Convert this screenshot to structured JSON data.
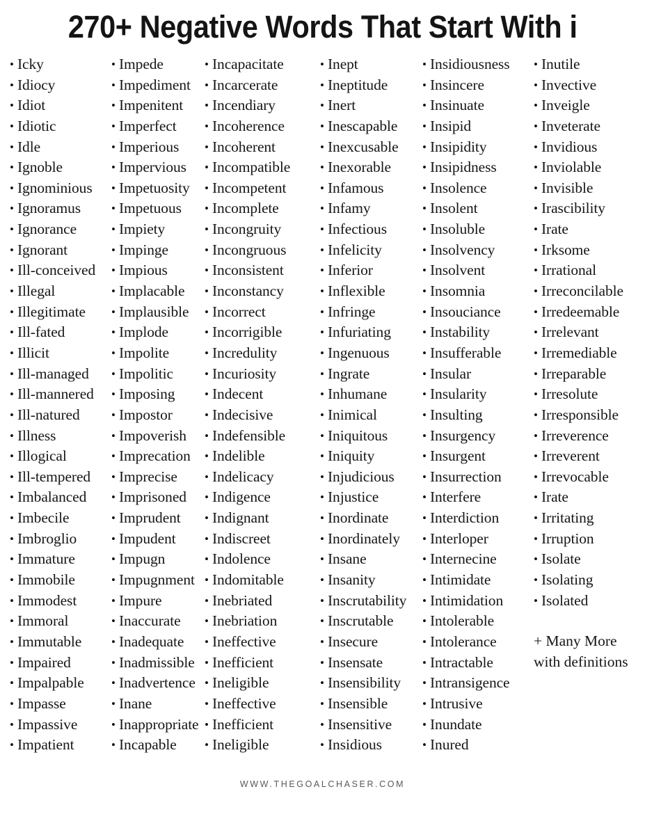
{
  "page": {
    "title": "270+ Negative Words That Start With i",
    "background_color": "#ffffff",
    "text_color": "#161616"
  },
  "footer": {
    "url": "WWW.THEGOALCHASER.COM",
    "color": "#59595b"
  },
  "bullet_glyph": "•",
  "note": {
    "line1": "+ Many More",
    "line2": "with definitions"
  },
  "columns": [
    {
      "index": 1,
      "words": [
        "Icky",
        "Idiocy",
        "Idiot",
        "Idiotic",
        "Idle",
        "Ignoble",
        "Ignominious",
        "Ignoramus",
        "Ignorance",
        "Ignorant",
        "Ill-conceived",
        "Illegal",
        "Illegitimate",
        "Ill-fated",
        "Illicit",
        "Ill-managed",
        "Ill-mannered",
        "Ill-natured",
        "Illness",
        "Illogical",
        "Ill-tempered",
        "Imbalanced",
        "Imbecile",
        "Imbroglio",
        "Immature",
        "Immobile",
        "Immodest",
        "Immoral",
        "Immutable",
        "Impaired",
        "Impalpable",
        "Impasse",
        "Impassive",
        "Impatient"
      ]
    },
    {
      "index": 2,
      "words": [
        "Impede",
        "Impediment",
        "Impenitent",
        "Imperfect",
        "Imperious",
        "Impervious",
        "Impetuosity",
        "Impetuous",
        "Impiety",
        "Impinge",
        "Impious",
        "Implacable",
        "Implausible",
        "Implode",
        "Impolite",
        "Impolitic",
        "Imposing",
        "Impostor",
        "Impoverish",
        "Imprecation",
        "Imprecise",
        "Imprisoned",
        "Imprudent",
        "Impudent",
        "Impugn",
        "Impugnment",
        "Impure",
        "Inaccurate",
        "Inadequate",
        "Inadmissible",
        "Inadvertence",
        "Inane",
        "Inappropriate",
        "Incapable"
      ]
    },
    {
      "index": 3,
      "words": [
        "Incapacitate",
        "Incarcerate",
        "Incendiary",
        "Incoherence",
        "Incoherent",
        "Incompatible",
        "Incompetent",
        "Incomplete",
        "Incongruity",
        "Incongruous",
        "Inconsistent",
        "Inconstancy",
        "Incorrect",
        "Incorrigible",
        "Incredulity",
        "Incuriosity",
        "Indecent",
        "Indecisive",
        "Indefensible",
        "Indelible",
        "Indelicacy",
        "Indigence",
        "Indignant",
        "Indiscreet",
        "Indolence",
        "Indomitable",
        "Inebriated",
        "Inebriation",
        "Ineffective",
        "Inefficient",
        "Ineligible",
        "Ineffective",
        "Inefficient",
        "Ineligible"
      ]
    },
    {
      "index": 4,
      "words": [
        "Inept",
        "Ineptitude",
        "Inert",
        "Inescapable",
        "Inexcusable",
        "Inexorable",
        "Infamous",
        "Infamy",
        "Infectious",
        "Infelicity",
        "Inferior",
        "Inflexible",
        "Infringe",
        "Infuriating",
        "Ingenuous",
        "Ingrate",
        "Inhumane",
        "Inimical",
        "Iniquitous",
        "Iniquity",
        "Injudicious",
        "Injustice",
        "Inordinate",
        "Inordinately",
        "Insane",
        "Insanity",
        "Inscrutability",
        "Inscrutable",
        "Insecure",
        "Insensate",
        "Insensibility",
        "Insensible",
        "Insensitive",
        "Insidious"
      ]
    },
    {
      "index": 5,
      "words": [
        "Insidiousness",
        "Insincere",
        "Insinuate",
        "Insipid",
        "Insipidity",
        "Insipidness",
        "Insolence",
        "Insolent",
        "Insoluble",
        "Insolvency",
        "Insolvent",
        "Insomnia",
        "Insouciance",
        "Instability",
        "Insufferable",
        "Insular",
        "Insularity",
        "Insulting",
        "Insurgency",
        "Insurgent",
        "Insurrection",
        "Interfere",
        "Interdiction",
        "Interloper",
        "Internecine",
        "Intimidate",
        "Intimidation",
        "Intolerable",
        "Intolerance",
        "Intractable",
        "Intransigence",
        "Intrusive",
        "Inundate",
        "Inured"
      ]
    },
    {
      "index": 6,
      "words": [
        "Inutile",
        "Invective",
        "Inveigle",
        "Inveterate",
        "Invidious",
        "Inviolable",
        "Invisible",
        "Irascibility",
        "Irate",
        "Irksome",
        "Irrational",
        "Irreconcilable",
        "Irredeemable",
        "Irrelevant",
        "Irremediable",
        "Irreparable",
        "Irresolute",
        "Irresponsible",
        "Irreverence",
        "Irreverent",
        "Irrevocable",
        "Irate",
        "Irritating",
        "Irruption",
        "Isolate",
        "Isolating",
        "Isolated"
      ]
    }
  ]
}
